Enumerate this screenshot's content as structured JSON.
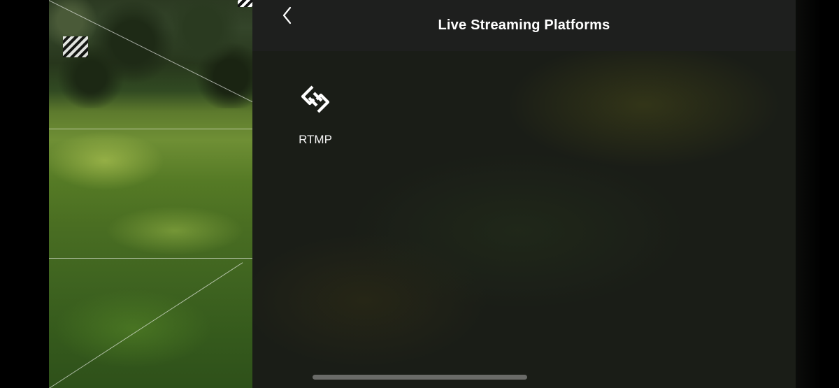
{
  "header": {
    "title": "Live Streaming Platforms",
    "back_icon": "chevron-left-icon"
  },
  "platforms": [
    {
      "label": "RTMP",
      "icon": "link-icon"
    }
  ],
  "colors": {
    "panel_background": "#1a1d17",
    "header_background": "#1e1f1e",
    "text": "#ffffff",
    "home_indicator": "#6a6b68"
  }
}
